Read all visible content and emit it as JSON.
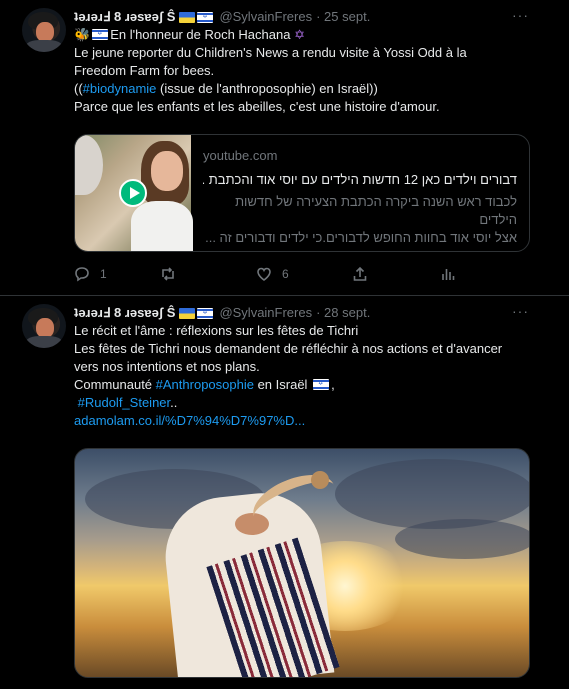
{
  "tweets": [
    {
      "author_name": "ʇǝɹǝɹℲ 8 ɹǝsɐǝʃ Ŝ",
      "handle": "@SylvainFreres",
      "date": "· 25 sept.",
      "more": "···",
      "line1": "En l'honneur de Roch Hachana",
      "line2": " Le jeune reporter du Children's News a rendu visite à Yossi Odd à la",
      "line3": "Freedom Farm for bees.",
      "line4_pre": "((",
      "line4_tag": "#biodynamie",
      "line4_post": " (issue de l'anthroposophie) en Israël))",
      "line5": "Parce que les enfants et les abeilles, c'est une histoire d'amour.",
      "card": {
        "domain": "youtube.com",
        "title": "דבורים וילדים כאן 12 חדשות הילדים עם יוסי אוד והכתבת ...",
        "desc_line1": "לכבוד ראש השנה ביקרה הכתבת הצעירה של חדשות הילדים",
        "desc_line2": "אצל יוסי אוד בחוות החופש לדבורים.כי ילדים ודבורים זה ..."
      },
      "reply_count": "1",
      "retweet_count": "",
      "like_count": "6"
    },
    {
      "author_name": "ʇǝɹǝɹℲ 8 ɹǝsɐǝʃ Ŝ",
      "handle": "@SylvainFreres",
      "date": "· 28 sept.",
      "more": "···",
      "line1": "Le récit et l'âme : réflexions sur les fêtes de Tichri",
      "line2": "Les fêtes de Tichri nous demandent de réfléchir à nos actions et d'avancer",
      "line3": "vers nos intentions et nos plans.",
      "line4_pre": "Communauté ",
      "line4_tag": "#Anthroposophie",
      "line4_post": " en Israël",
      "line5_tag": "#Rudolf_Steiner",
      "line5_post": "..",
      "link": "adamolam.co.il/%D7%94%D7%97%D..."
    }
  ],
  "colors": {
    "accent": "#1d9bf0",
    "muted": "#71767b",
    "background": "#000000",
    "play": "#00ba7c"
  },
  "icons": [
    "reply-icon",
    "retweet-icon",
    "like-icon",
    "share-icon",
    "stats-icon",
    "play-icon"
  ]
}
